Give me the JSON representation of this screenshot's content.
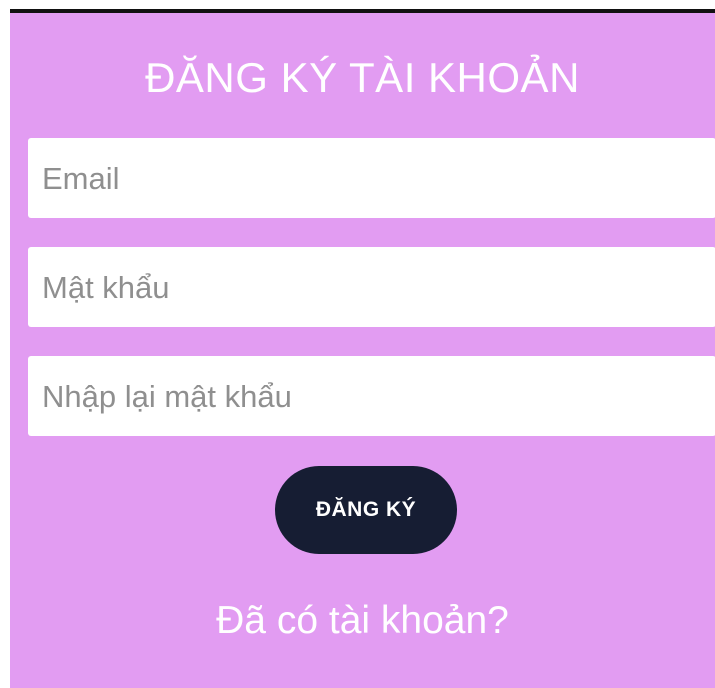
{
  "form": {
    "title": "ĐĂNG KÝ TÀI KHOẢN",
    "email_placeholder": "Email",
    "password_placeholder": "Mật khẩu",
    "confirm_password_placeholder": "Nhập lại mật khẩu",
    "register_label": "ĐĂNG KÝ",
    "login_link": "Đã có tài khoản?"
  },
  "colors": {
    "background": "#e29cf2",
    "button": "#161d33",
    "text_on_background": "#ffffff",
    "field_background": "#ffffff",
    "placeholder": "#8f8f8f"
  }
}
